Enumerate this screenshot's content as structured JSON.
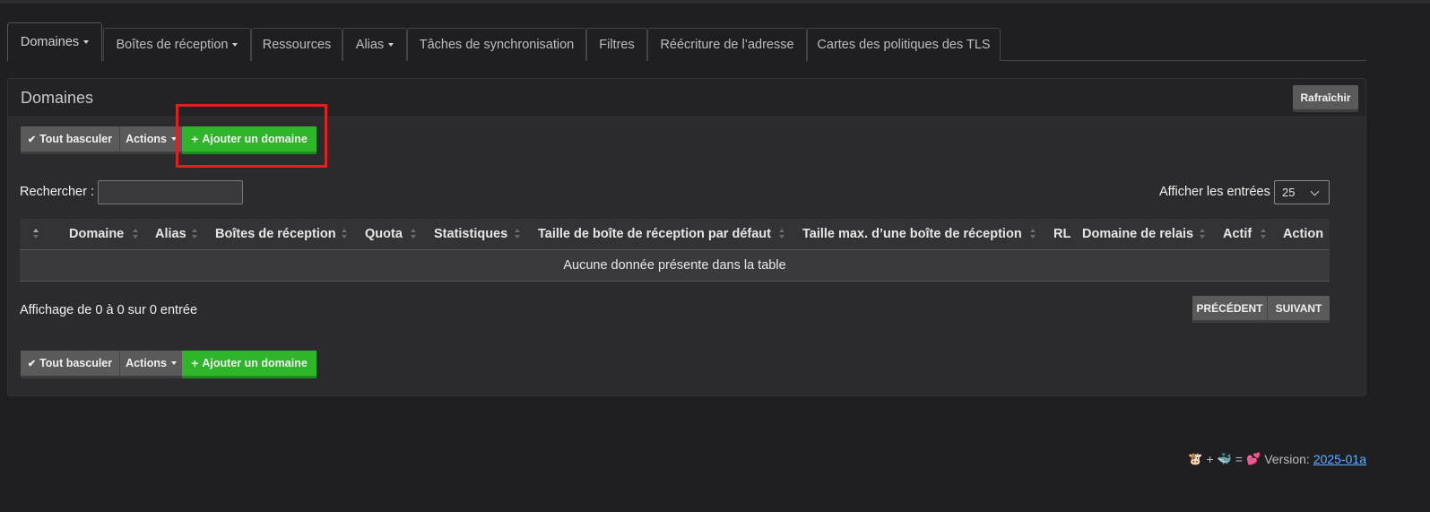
{
  "tabs": [
    {
      "label": "Domaines",
      "dropdown": true,
      "active": true
    },
    {
      "label": "Boîtes de réception",
      "dropdown": true
    },
    {
      "label": "Ressources",
      "dropdown": false
    },
    {
      "label": "Alias",
      "dropdown": true
    },
    {
      "label": "Tâches de synchronisation",
      "dropdown": false
    },
    {
      "label": "Filtres",
      "dropdown": false
    },
    {
      "label": "Réécriture de l’adresse",
      "dropdown": false
    },
    {
      "label": "Cartes des politiques des TLS",
      "dropdown": false
    }
  ],
  "panel": {
    "title": "Domaines",
    "refresh_label": "Rafraîchir"
  },
  "toolbar": {
    "toggle_all": "Tout basculer",
    "actions": "Actions",
    "add_domain": "Ajouter un domaine"
  },
  "search": {
    "label": "Rechercher :",
    "value": ""
  },
  "entries": {
    "label": "Afficher les entrées",
    "value": "25"
  },
  "table": {
    "columns": [
      "Domaine",
      "Alias",
      "Boîtes de réception",
      "Quota",
      "Statistiques",
      "Taille de boîte de réception par défaut",
      "Taille max. d’une boîte de réception",
      "RL",
      "Domaine de relais",
      "Actif",
      "Action"
    ],
    "empty_message": "Aucune donnée présente dans la table"
  },
  "pagination": {
    "info": "Affichage de 0 à 0 sur 0 entrée",
    "previous": "PRÉCÉDENT",
    "next": "SUIVANT"
  },
  "footer": {
    "version_label": "Version:",
    "version": "2025-01a",
    "plus": "+",
    "equals": "="
  },
  "colors": {
    "accent_green": "#2fb52a",
    "highlight_red": "#e02020",
    "link_blue": "#5ab0ff"
  }
}
